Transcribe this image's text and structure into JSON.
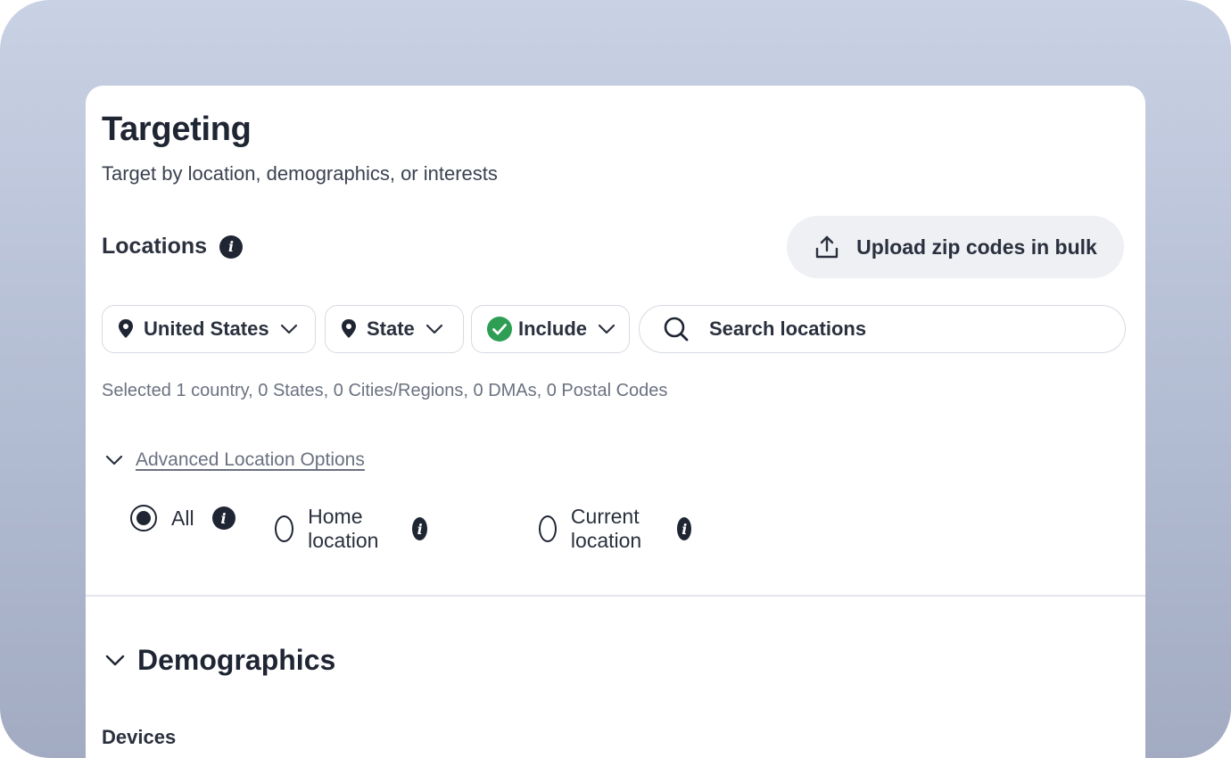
{
  "header": {
    "title": "Targeting",
    "subtitle": "Target by location, demographics, or interests"
  },
  "locations": {
    "label": "Locations",
    "upload_label": "Upload zip codes in bulk",
    "filters": {
      "country": "United States",
      "region_type": "State",
      "mode": "Include"
    },
    "search_placeholder": "Search locations",
    "selected_summary": "Selected 1 country, 0 States, 0 Cities/Regions, 0 DMAs, 0 Postal Codes",
    "advanced_label": "Advanced Location Options",
    "options": [
      {
        "label": "All",
        "selected": true
      },
      {
        "label": "Home location",
        "selected": false
      },
      {
        "label": "Current location",
        "selected": false
      }
    ]
  },
  "demographics": {
    "label": "Demographics",
    "devices_label": "Devices"
  },
  "colors": {
    "include_check": "#2e9e55",
    "text_dark": "#1f2533",
    "muted": "#6b7180"
  }
}
